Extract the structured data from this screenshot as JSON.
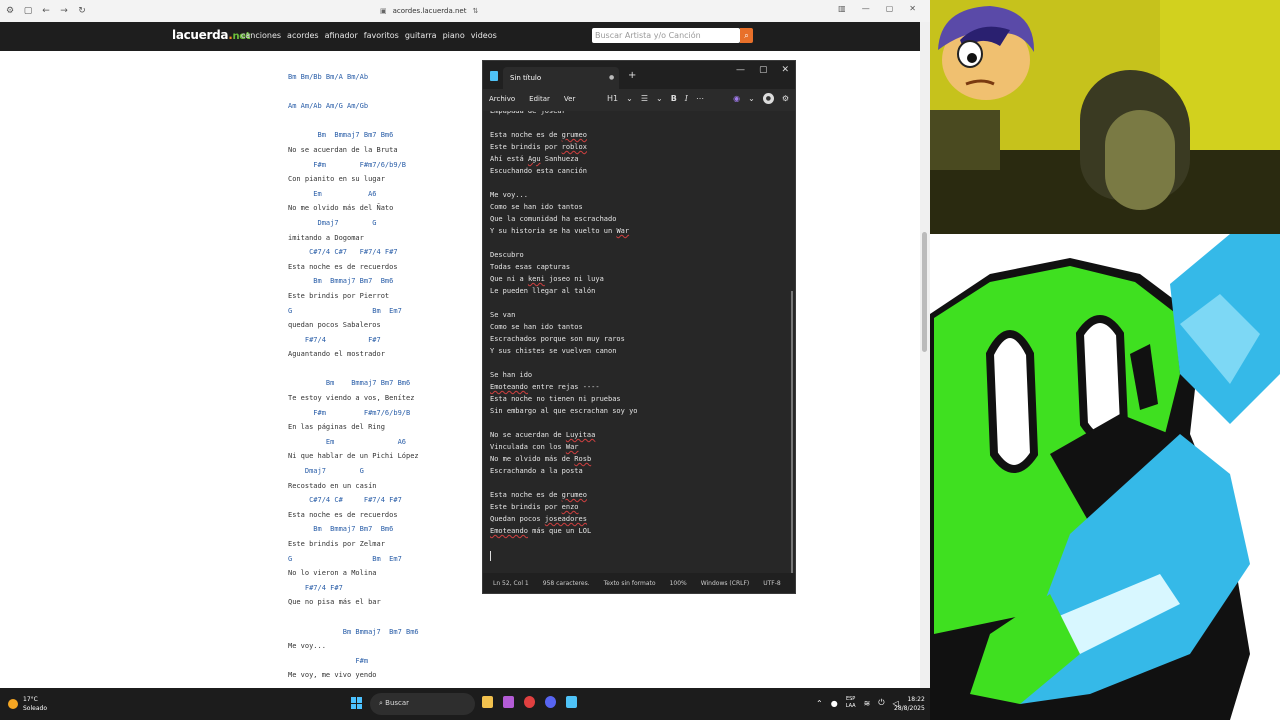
{
  "browser": {
    "url": "acordes.lacuerda.net",
    "site": {
      "logo": {
        "main": "lacuerda",
        "dot": ".",
        "net": "net"
      },
      "nav": [
        "canciones",
        "acordes",
        "afinador",
        "favoritos",
        "guitarra",
        "piano",
        "videos"
      ],
      "search_placeholder": "Buscar Artista y/o Canción"
    },
    "song_lines": [
      {
        "t": "Bm Bm/Bb Bm/A Bm/Ab",
        "c": true
      },
      {
        "t": "",
        "c": false
      },
      {
        "t": "Am Am/Ab Am/G Am/Gb",
        "c": true
      },
      {
        "t": "",
        "c": false
      },
      {
        "t": "       Bm  Bmmaj7 Bm7 Bm6",
        "c": true
      },
      {
        "t": "No se acuerdan de la Bruta",
        "c": false
      },
      {
        "t": "      F#m        F#m7/6/b9/B",
        "c": true
      },
      {
        "t": "Con pianito en su lugar",
        "c": false
      },
      {
        "t": "      Em           A6",
        "c": true
      },
      {
        "t": "No me olvido más del Ñato",
        "c": false
      },
      {
        "t": "       Dmaj7        G",
        "c": true
      },
      {
        "t": "imitando a Dogomar",
        "c": false
      },
      {
        "t": "     C#7/4 C#7   F#7/4 F#7",
        "c": true
      },
      {
        "t": "Esta noche es de recuerdos",
        "c": false
      },
      {
        "t": "      Bm  Bmmaj7 Bm7  Bm6",
        "c": true
      },
      {
        "t": "Este brindis por Pierrot",
        "c": false
      },
      {
        "t": "G                   Bm  Em7",
        "c": true
      },
      {
        "t": "quedan pocos Sabaleros",
        "c": false
      },
      {
        "t": "    F#7/4          F#7",
        "c": true
      },
      {
        "t": "Aguantando el mostrador",
        "c": false
      },
      {
        "t": "",
        "c": false
      },
      {
        "t": "         Bm    Bmmaj7 Bm7 Bm6",
        "c": true
      },
      {
        "t": "Te estoy viendo a vos, Benítez",
        "c": false
      },
      {
        "t": "      F#m         F#m7/6/b9/B",
        "c": true
      },
      {
        "t": "En las páginas del Ring",
        "c": false
      },
      {
        "t": "         Em               A6",
        "c": true
      },
      {
        "t": "Ni que hablar de un Pichi López",
        "c": false
      },
      {
        "t": "    Dmaj7        G",
        "c": true
      },
      {
        "t": "Recostado en un casín",
        "c": false
      },
      {
        "t": "     C#7/4 C#     F#7/4 F#7",
        "c": true
      },
      {
        "t": "Esta noche es de recuerdos",
        "c": false
      },
      {
        "t": "      Bm  Bmmaj7 Bm7  Bm6",
        "c": true
      },
      {
        "t": "Este brindis por Zelmar",
        "c": false
      },
      {
        "t": "G                   Bm  Em7",
        "c": true
      },
      {
        "t": "No lo vieron a Molina",
        "c": false
      },
      {
        "t": "    F#7/4 F#7",
        "c": true
      },
      {
        "t": "Que no pisa más el bar",
        "c": false
      },
      {
        "t": "",
        "c": false
      },
      {
        "t": "             Bm Bmmaj7  Bm7 Bm6",
        "c": true
      },
      {
        "t": "Me voy...",
        "c": false
      },
      {
        "t": "                F#m",
        "c": true
      },
      {
        "t": "Me voy, me vivo yendo",
        "c": false
      }
    ]
  },
  "notepad": {
    "tab_title": "Sin título",
    "menus": [
      "Archivo",
      "Editar",
      "Ver"
    ],
    "heading_tool": "H1",
    "lines": [
      {
        "t": "Empapada de josear"
      },
      {
        "t": ""
      },
      {
        "t": "Esta noche es de grumeo",
        "s": "grumeo"
      },
      {
        "t": "Este brindis por roblox",
        "s": "roblox"
      },
      {
        "t": "Ahí está Agu Sanhueza",
        "s": "Agu"
      },
      {
        "t": "Escuchando esta canción"
      },
      {
        "t": ""
      },
      {
        "t": "Me voy..."
      },
      {
        "t": "Como se han ido tantos"
      },
      {
        "t": "Que la comunidad ha escrachado"
      },
      {
        "t": "Y su historia se ha vuelto un War",
        "s": "War"
      },
      {
        "t": ""
      },
      {
        "t": "Descubro"
      },
      {
        "t": "Todas esas capturas"
      },
      {
        "t": "Que ni a keni joseo ni luya",
        "s": "keni"
      },
      {
        "t": "Le pueden llegar al talón"
      },
      {
        "t": ""
      },
      {
        "t": "Se van"
      },
      {
        "t": "Como se han ido tantos"
      },
      {
        "t": "Escrachados porque son muy raros"
      },
      {
        "t": "Y sus chistes se vuelven canon"
      },
      {
        "t": ""
      },
      {
        "t": "Se han ido"
      },
      {
        "t": "Emoteando entre rejas ----",
        "s": "Emoteando"
      },
      {
        "t": "Esta noche no tienen ni pruebas"
      },
      {
        "t": "Sin embargo al que escrachan soy yo"
      },
      {
        "t": ""
      },
      {
        "t": "No se acuerdan de Luyitaa",
        "s": "Luyitaa"
      },
      {
        "t": "Vinculada con los War",
        "s": "War"
      },
      {
        "t": "No me olvido más de Rosb",
        "s": "Rosb"
      },
      {
        "t": "Escrachando a la posta"
      },
      {
        "t": ""
      },
      {
        "t": "Esta noche es de grumeo",
        "s": "grumeo"
      },
      {
        "t": "Este brindis por enzo",
        "s": "enzo"
      },
      {
        "t": "Quedan pocos joseadores",
        "s": "joseadores"
      },
      {
        "t": "Emoteando más que un LOL",
        "s": "Emoteando"
      }
    ],
    "status": {
      "position": "Ln 52, Col 1",
      "chars": "958 caracteres.",
      "format": "Texto sin formato",
      "zoom": "100%",
      "eol": "Windows (CRLF)",
      "encoding": "UTF-8"
    }
  },
  "taskbar": {
    "weather_temp": "17°C",
    "weather_desc": "Soleado",
    "search_label": "Buscar",
    "lang_top": "ESP",
    "lang_bottom": "LAA",
    "time": "18:22",
    "date": "28/8/2025"
  },
  "colors": {
    "chord": "#2a5ea8",
    "site_accent": "#e8702a",
    "notepad_bg": "#272727",
    "taskbar_bg": "#1c1c1c",
    "gameart_green": "#3fe020",
    "gameart_blue": "#35b9e8"
  }
}
